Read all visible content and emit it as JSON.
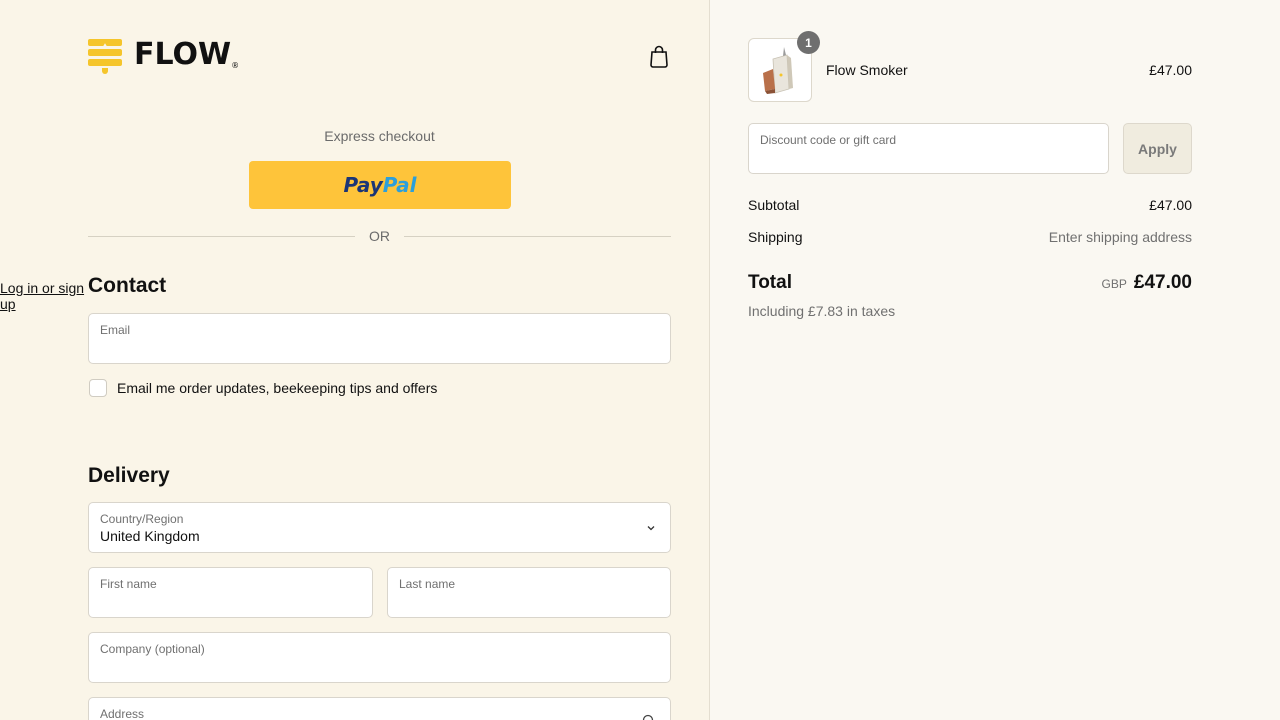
{
  "brand": {
    "name": "FLOW",
    "mark": "®",
    "accent": "#f5c52b"
  },
  "header": {
    "cart_icon": "shopping-bag-icon"
  },
  "express": {
    "label": "Express checkout",
    "paypal_part1": "Pay",
    "paypal_part2": "Pal",
    "divider": "OR"
  },
  "contact": {
    "heading": "Contact",
    "login_link": "Log in or sign up",
    "email_label": "Email",
    "email_value": "",
    "marketing_label": "Email me order updates, beekeeping tips and offers",
    "marketing_checked": false
  },
  "delivery": {
    "heading": "Delivery",
    "country_label": "Country/Region",
    "country_value": "United Kingdom",
    "first_name_label": "First name",
    "last_name_label": "Last name",
    "company_label": "Company (optional)",
    "address_label": "Address"
  },
  "order": {
    "item": {
      "name": "Flow Smoker",
      "price": "£47.00",
      "quantity": "1"
    },
    "discount_placeholder": "Discount code or gift card",
    "apply_label": "Apply",
    "subtotal_label": "Subtotal",
    "subtotal_value": "£47.00",
    "shipping_label": "Shipping",
    "shipping_value": "Enter shipping address",
    "total_label": "Total",
    "currency": "GBP",
    "total_value": "£47.00",
    "tax_note": "Including £7.83 in taxes"
  }
}
